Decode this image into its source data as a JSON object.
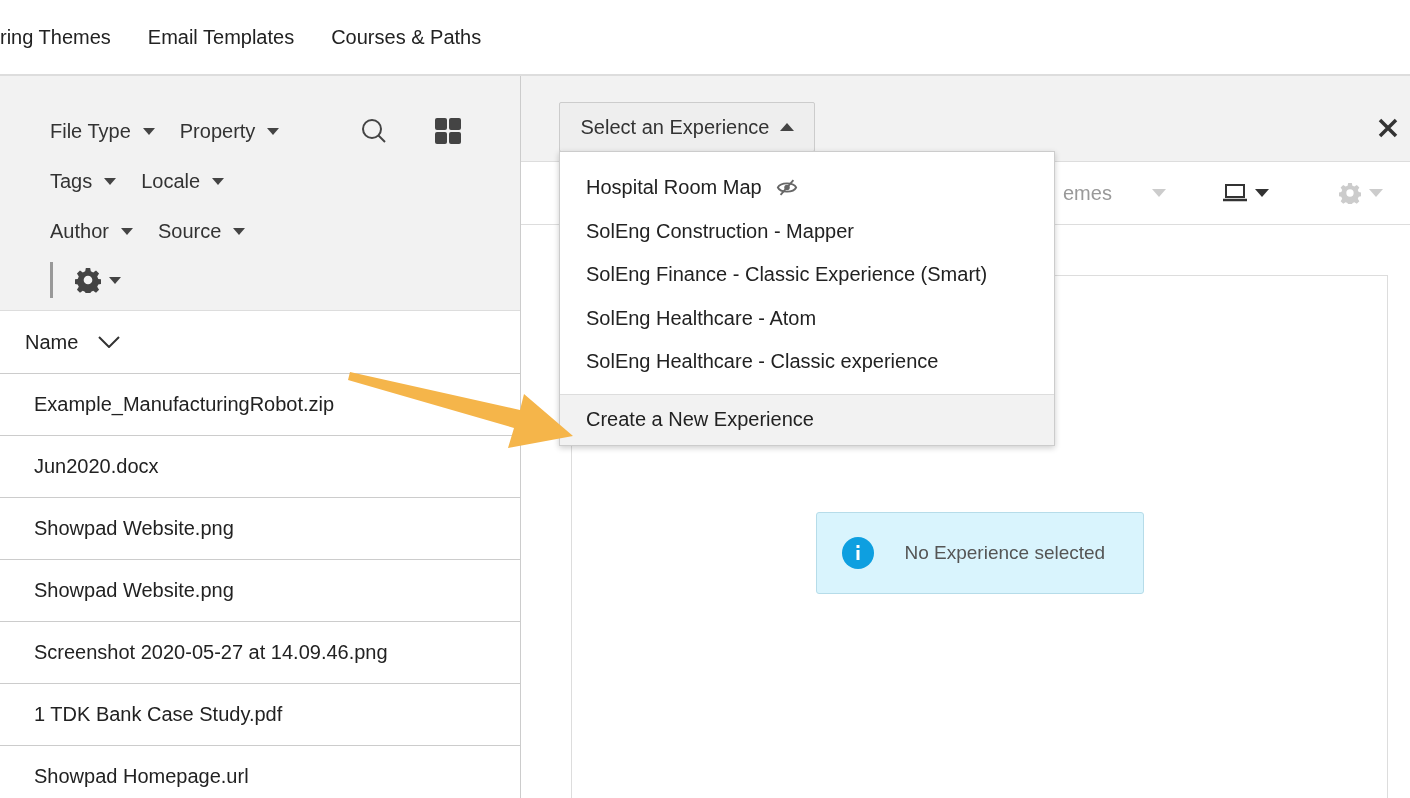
{
  "top_tabs": [
    "ring Themes",
    "Email Templates",
    "Courses & Paths"
  ],
  "filters": {
    "rows": [
      [
        "File Type",
        "Property"
      ],
      [
        "Tags",
        "Locale"
      ],
      [
        "Author",
        "Source"
      ]
    ]
  },
  "file_list": {
    "sort_column": "Name",
    "rows": [
      "Example_ManufacturingRobot.zip",
      "Jun2020.docx",
      "Showpad Website.png",
      "Showpad Website.png",
      "Screenshot 2020-05-27 at 14.09.46.png",
      "1 TDK Bank Case Study.pdf",
      "Showpad Homepage.url"
    ]
  },
  "experience_panel": {
    "select_button": "Select an Experience",
    "dropdown": {
      "items": [
        {
          "label": "Hospital Room Map",
          "hidden": true
        },
        {
          "label": "SolEng Construction - Mapper",
          "hidden": false
        },
        {
          "label": "SolEng Finance - Classic Experience (Smart)",
          "hidden": false
        },
        {
          "label": "SolEng Healthcare - Atom",
          "hidden": false
        },
        {
          "label": "SolEng Healthcare - Classic experience",
          "hidden": false
        }
      ],
      "footer": "Create a New Experience"
    },
    "toolbar": {
      "themes_label": "emes"
    },
    "alert": "No Experience selected"
  }
}
